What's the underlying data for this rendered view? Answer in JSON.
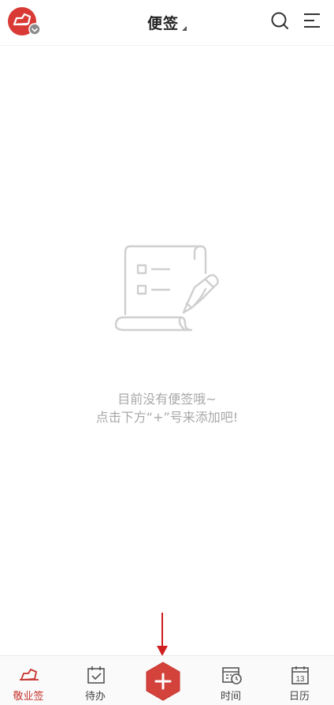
{
  "header": {
    "title": "便签"
  },
  "empty_state": {
    "line1": "目前没有便签哦~",
    "line2": "点击下方“+”号来添加吧!"
  },
  "bottom_nav": {
    "items": [
      {
        "label": "敬业签",
        "icon": "cloud-note-icon",
        "active": true
      },
      {
        "label": "待办",
        "icon": "calendar-check-icon",
        "active": false
      },
      {
        "label": "时间",
        "icon": "calendar-clock-icon",
        "active": false
      },
      {
        "label": "日历",
        "icon": "calendar-date-icon",
        "active": false,
        "day": "13"
      }
    ],
    "add_icon": "plus-icon"
  },
  "colors": {
    "accent": "#c7332e",
    "muted_text": "#a8a8a8",
    "icon_gray": "#555555"
  }
}
